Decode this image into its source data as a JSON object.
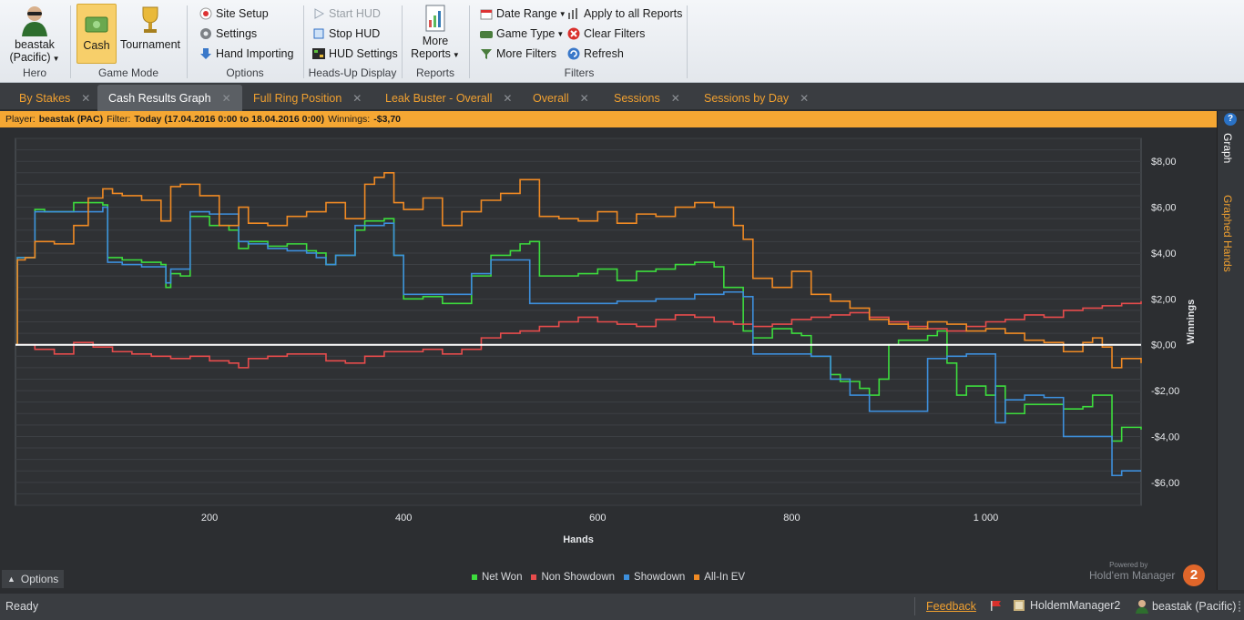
{
  "ribbon": {
    "hero": {
      "name": "beastak",
      "site": "(Pacific)",
      "label": "Hero"
    },
    "game_mode": {
      "cash": "Cash",
      "tournament": "Tournament",
      "label": "Game Mode"
    },
    "options": {
      "site_setup": "Site Setup",
      "settings": "Settings",
      "hand_importing": "Hand Importing",
      "label": "Options"
    },
    "hud": {
      "start": "Start HUD",
      "stop": "Stop HUD",
      "settings": "HUD Settings",
      "label": "Heads-Up Display"
    },
    "reports": {
      "more1": "More",
      "more2": "Reports",
      "label": "Reports"
    },
    "filters": {
      "date_range": "Date Range",
      "game_type": "Game Type",
      "more_filters": "More Filters",
      "apply_all": "Apply to all Reports",
      "clear": "Clear Filters",
      "refresh": "Refresh",
      "label": "Filters"
    }
  },
  "tabs": [
    {
      "label": "By Stakes",
      "active": false
    },
    {
      "label": "Cash Results Graph",
      "active": true
    },
    {
      "label": "Full Ring Position",
      "active": false
    },
    {
      "label": "Leak Buster - Overall",
      "active": false
    },
    {
      "label": "Overall",
      "active": false
    },
    {
      "label": "Sessions",
      "active": false
    },
    {
      "label": "Sessions by Day",
      "active": false
    }
  ],
  "filterbar": {
    "player_label": "Player:",
    "player": "beastak (PAC)",
    "filter_label": "Filter:",
    "filter": "Today (17.04.2016 0:00 to 18.04.2016 0:00)",
    "winnings_label": "Winnings:",
    "winnings": "-$3,70"
  },
  "side_tabs": {
    "graph": "Graph",
    "graphed_hands": "Graphed Hands"
  },
  "chart_data": {
    "type": "line",
    "xlabel": "Hands",
    "ylabel": "Winnings",
    "xlim": [
      0,
      1160
    ],
    "ylim": [
      -7,
      9
    ],
    "x_ticks": [
      200,
      400,
      600,
      800,
      1000
    ],
    "x_tick_labels": [
      "200",
      "400",
      "600",
      "800",
      "1 000"
    ],
    "y_ticks": [
      8,
      6,
      4,
      2,
      0,
      -2,
      -4,
      -6
    ],
    "y_tick_labels": [
      "$8,00",
      "$6,00",
      "$4,00",
      "$2,00",
      "$0,00",
      "-$2,00",
      "-$4,00",
      "-$6,00"
    ],
    "grid": true,
    "legend_position": "bottom",
    "series": [
      {
        "name": "Net Won",
        "color": "#3ddc3d",
        "x": [
          0,
          2,
          10,
          20,
          30,
          60,
          90,
          95,
          110,
          130,
          150,
          155,
          160,
          170,
          180,
          200,
          220,
          230,
          240,
          260,
          280,
          300,
          310,
          320,
          330,
          350,
          360,
          380,
          390,
          400,
          420,
          440,
          460,
          470,
          490,
          510,
          520,
          530,
          540,
          560,
          580,
          600,
          620,
          640,
          660,
          680,
          700,
          720,
          730,
          750,
          760,
          780,
          800,
          810,
          820,
          840,
          850,
          870,
          880,
          890,
          900,
          910,
          940,
          950,
          960,
          970,
          980,
          1000,
          1010,
          1020,
          1040,
          1060,
          1080,
          1100,
          1110,
          1120,
          1130,
          1140,
          1160
        ],
        "y": [
          0,
          3.8,
          3.8,
          5.9,
          5.8,
          6.2,
          6.1,
          3.8,
          3.7,
          3.6,
          3.5,
          2.5,
          3.1,
          3,
          5.6,
          5.2,
          5,
          4.2,
          4.5,
          4.3,
          4.4,
          4.1,
          4,
          3.5,
          3.9,
          5,
          5.4,
          5.5,
          3.9,
          2,
          2.1,
          1.8,
          1.8,
          3,
          3.9,
          4.1,
          4.4,
          4.5,
          3,
          3,
          3.1,
          3.3,
          2.8,
          3.2,
          3.3,
          3.5,
          3.6,
          3.4,
          2.5,
          0.6,
          0.3,
          0.7,
          0.5,
          0.4,
          -0.5,
          -1.3,
          -1.6,
          -1.9,
          -2.2,
          -1.5,
          0,
          0.2,
          0.4,
          0.6,
          -0.8,
          -2.2,
          -1.8,
          -2.2,
          -1.8,
          -3,
          -2.6,
          -2.6,
          -2.8,
          -2.7,
          -2.2,
          -2.2,
          -4.2,
          -3.6,
          -3.7
        ]
      },
      {
        "name": "Non Showdown",
        "color": "#e74c4c",
        "x": [
          0,
          20,
          40,
          60,
          80,
          100,
          120,
          140,
          160,
          180,
          200,
          220,
          230,
          240,
          260,
          280,
          300,
          320,
          340,
          360,
          380,
          400,
          420,
          440,
          460,
          480,
          500,
          520,
          540,
          560,
          580,
          600,
          620,
          640,
          660,
          680,
          700,
          720,
          740,
          760,
          780,
          800,
          820,
          840,
          860,
          880,
          900,
          920,
          940,
          960,
          980,
          1000,
          1020,
          1040,
          1060,
          1080,
          1100,
          1120,
          1140,
          1160
        ],
        "y": [
          0,
          -0.2,
          -0.4,
          0.1,
          -0.1,
          -0.3,
          -0.4,
          -0.5,
          -0.6,
          -0.5,
          -0.7,
          -0.8,
          -1,
          -0.6,
          -0.5,
          -0.4,
          -0.4,
          -0.7,
          -0.8,
          -0.5,
          -0.3,
          -0.3,
          -0.2,
          -0.4,
          -0.2,
          0.3,
          0.5,
          0.6,
          0.8,
          1,
          1.2,
          1,
          0.9,
          0.8,
          1.1,
          1.3,
          1.2,
          1,
          0.9,
          0.8,
          0.9,
          1.1,
          1.2,
          1.3,
          1.4,
          1.2,
          1,
          0.8,
          0.7,
          0.6,
          0.8,
          1,
          1.1,
          1.3,
          1.2,
          1.5,
          1.6,
          1.7,
          1.8,
          1.9
        ]
      },
      {
        "name": "Showdown",
        "color": "#3d8fdc",
        "x": [
          0,
          2,
          10,
          20,
          90,
          95,
          110,
          130,
          155,
          160,
          180,
          200,
          230,
          240,
          260,
          280,
          300,
          310,
          320,
          330,
          350,
          380,
          390,
          400,
          460,
          470,
          490,
          520,
          530,
          560,
          600,
          620,
          660,
          700,
          730,
          750,
          760,
          810,
          820,
          840,
          860,
          880,
          900,
          940,
          960,
          980,
          1000,
          1010,
          1020,
          1040,
          1060,
          1080,
          1120,
          1130,
          1140,
          1160
        ],
        "y": [
          0,
          3.8,
          3.8,
          5.8,
          6,
          3.6,
          3.5,
          3.4,
          2.7,
          3.3,
          5.8,
          5.7,
          4.5,
          4.4,
          4.2,
          4.1,
          4,
          3.8,
          3.5,
          3.9,
          5.2,
          5.3,
          3.9,
          2.2,
          2.2,
          3.1,
          3.7,
          3.7,
          1.8,
          1.8,
          1.8,
          1.9,
          2,
          2.2,
          2.3,
          2.1,
          -0.4,
          -0.4,
          -0.5,
          -1.5,
          -2.2,
          -2.9,
          -2.9,
          -0.6,
          -0.5,
          -0.4,
          -0.4,
          -3.4,
          -2.4,
          -2.2,
          -2.3,
          -4,
          -4,
          -5.7,
          -5.5,
          -5.5
        ]
      },
      {
        "name": "All-In EV",
        "color": "#f08a24",
        "x": [
          0,
          2,
          10,
          20,
          40,
          60,
          75,
          90,
          100,
          110,
          130,
          150,
          160,
          170,
          190,
          210,
          230,
          240,
          260,
          280,
          300,
          320,
          340,
          360,
          370,
          380,
          390,
          400,
          420,
          440,
          460,
          480,
          500,
          520,
          540,
          560,
          580,
          600,
          620,
          640,
          660,
          680,
          700,
          720,
          740,
          750,
          760,
          780,
          800,
          820,
          840,
          860,
          880,
          900,
          920,
          940,
          960,
          980,
          1000,
          1020,
          1040,
          1060,
          1080,
          1100,
          1110,
          1120,
          1130,
          1140,
          1160
        ],
        "y": [
          0,
          3.7,
          3.8,
          4.5,
          4.4,
          5.2,
          6.4,
          6.8,
          6.6,
          6.5,
          6.3,
          5.4,
          6.9,
          7,
          6.5,
          5.2,
          6,
          5.3,
          5.2,
          5.6,
          5.8,
          6.2,
          5.5,
          7,
          7.3,
          7.5,
          6.2,
          5.9,
          6.4,
          5.2,
          5.8,
          6.3,
          6.6,
          7.2,
          5.6,
          5.5,
          5.4,
          5.8,
          5.3,
          5.7,
          5.6,
          6,
          6.2,
          6,
          5.2,
          4.6,
          2.9,
          2.5,
          3.2,
          2.2,
          1.9,
          1.6,
          1.1,
          0.9,
          0.7,
          1.0,
          0.9,
          0.6,
          0.7,
          0.5,
          0.2,
          0.1,
          -0.3,
          0.1,
          0.3,
          -0.1,
          -1.0,
          -0.6,
          -0.8
        ]
      }
    ]
  },
  "legend": {
    "items": [
      "Net Won",
      "Non Showdown",
      "Showdown",
      "All-In EV"
    ]
  },
  "options_button": "Options",
  "branding": {
    "powered_by": "Powered by",
    "product": "Hold'em Manager",
    "logo_text": "2"
  },
  "status": {
    "ready": "Ready",
    "feedback": "Feedback",
    "app": "HoldemManager2",
    "user": "beastak (Pacific)"
  }
}
